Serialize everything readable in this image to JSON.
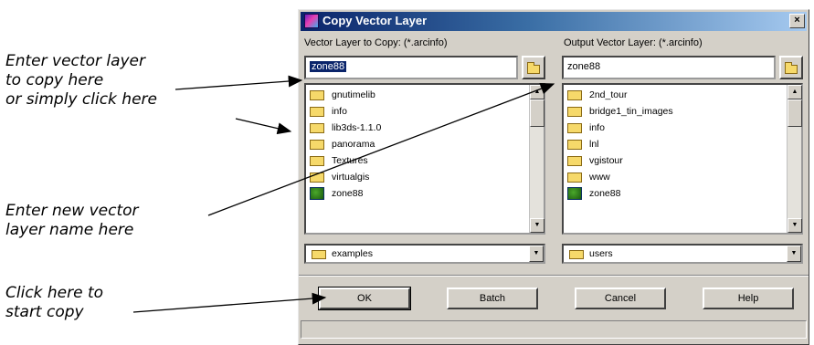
{
  "callouts": {
    "enter_layer": [
      "Enter vector layer",
      "to copy here",
      "or simply click here"
    ],
    "new_name": [
      "Enter new vector",
      "layer name here"
    ],
    "start_copy": [
      "Click here to",
      "start copy"
    ]
  },
  "dialog": {
    "title": "Copy Vector Layer",
    "close_glyph": "×",
    "left_label": "Vector Layer to Copy: (*.arcinfo)",
    "right_label": "Output Vector Layer: (*.arcinfo)",
    "left_input": "zone88",
    "right_input": "zone88",
    "left_list": [
      {
        "name": "gnutimelib",
        "icon": "folder-icon"
      },
      {
        "name": "info",
        "icon": "folder-icon"
      },
      {
        "name": "lib3ds-1.1.0",
        "icon": "folder-icon"
      },
      {
        "name": "panorama",
        "icon": "folder-icon"
      },
      {
        "name": "Textures",
        "icon": "folder-icon"
      },
      {
        "name": "virtualgis",
        "icon": "folder-icon"
      },
      {
        "name": "zone88",
        "icon": "vector-layer-icon"
      }
    ],
    "right_list": [
      {
        "name": "2nd_tour",
        "icon": "folder-icon"
      },
      {
        "name": "bridge1_tin_images",
        "icon": "folder-icon"
      },
      {
        "name": "info",
        "icon": "folder-icon"
      },
      {
        "name": "lnl",
        "icon": "folder-icon"
      },
      {
        "name": "vgistour",
        "icon": "folder-icon"
      },
      {
        "name": "www",
        "icon": "folder-icon"
      },
      {
        "name": "zone88",
        "icon": "vector-layer-icon"
      }
    ],
    "left_dir": "examples",
    "right_dir": "users",
    "buttons": {
      "ok": "OK",
      "batch": "Batch",
      "cancel": "Cancel",
      "help": "Help"
    },
    "selection_color": "#0a246a"
  }
}
